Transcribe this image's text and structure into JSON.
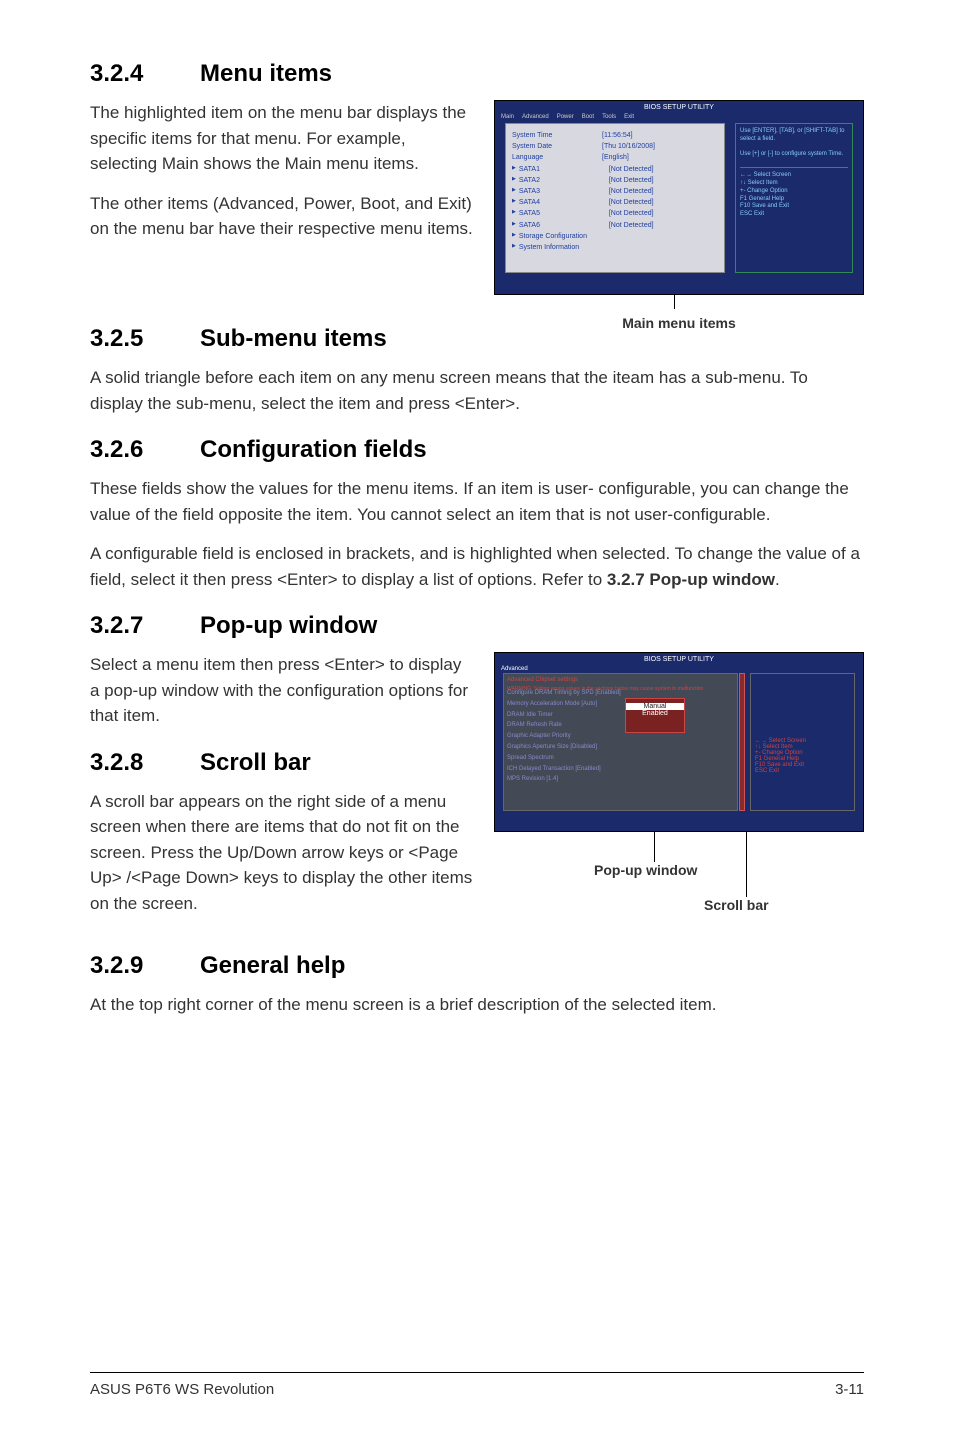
{
  "sec324": {
    "no": "3.2.4",
    "title": "Menu items",
    "p1": "The highlighted item on the menu bar displays the specific items for that menu. For example, selecting Main shows the Main menu items.",
    "p2": "The other items (Advanced, Power, Boot, and Exit) on the menu bar have their respective menu items."
  },
  "fig1": {
    "title_top": "BIOS SETUP UTILITY",
    "menu": [
      "Main",
      "Advanced",
      "Power",
      "Boot",
      "Tools",
      "Exit"
    ],
    "rows": [
      {
        "lbl": "System Time",
        "val": "[11:56:54]"
      },
      {
        "lbl": "System Date",
        "val": "[Thu 10/16/2008]"
      },
      {
        "lbl": "Language",
        "val": "[English]"
      },
      {
        "lbl": "SATA1",
        "val": "[Not Detected]",
        "tri": true
      },
      {
        "lbl": "SATA2",
        "val": "[Not Detected]",
        "tri": true
      },
      {
        "lbl": "SATA3",
        "val": "[Not Detected]",
        "tri": true
      },
      {
        "lbl": "SATA4",
        "val": "[Not Detected]",
        "tri": true
      },
      {
        "lbl": "SATA5",
        "val": "[Not Detected]",
        "tri": true
      },
      {
        "lbl": "SATA6",
        "val": "[Not Detected]",
        "tri": true
      },
      {
        "lbl": "Storage Configuration",
        "val": "",
        "tri": true
      },
      {
        "lbl": "System Information",
        "val": "",
        "tri": true
      }
    ],
    "help": "Use [ENTER], [TAB], or [SHIFT-TAB] to select a field.\n\nUse [+] or [-] to configure system Time.",
    "legend": "←→   Select Screen\n↑↓   Select Item\n+-   Change Option\nF1   General Help\nF10  Save and Exit\nESC  Exit",
    "caption": "Main menu items"
  },
  "sec325": {
    "no": "3.2.5",
    "title": "Sub-menu items",
    "p1": "A solid triangle before each item on any menu screen means that the iteam has a sub-menu. To display the sub-menu, select the item and press <Enter>."
  },
  "sec326": {
    "no": "3.2.6",
    "title": "Configuration fields",
    "p1": "These fields show the values for the menu items. If an item is user- configurable, you can change the value of the field opposite the item. You cannot select an item that is not user-configurable.",
    "p2a": "A configurable field is enclosed in brackets, and is highlighted when selected. To change the value of a field, select it then press <Enter> to display a list of options. Refer to ",
    "p2b": "3.2.7 Pop-up window",
    "p2c": "."
  },
  "sec327": {
    "no": "3.2.7",
    "title": "Pop-up window",
    "p1": "Select a menu item then press <Enter> to display a pop-up window with the configuration options for that item."
  },
  "sec328": {
    "no": "3.2.8",
    "title": "Scroll bar",
    "p1": "A scroll bar appears on the right side of a menu screen when there are items that do not fit on the screen. Press the Up/Down arrow keys or <Page Up> /<Page Down> keys to display the other items on the screen."
  },
  "fig2": {
    "title_top": "BIOS SETUP UTILITY",
    "menu_sel": "Advanced",
    "header": "Advanced Chipset settings",
    "warning": "WARNING: Setting wrong values in the sections below may cause system to malfunction",
    "lines": [
      "Configure DRAM Timing by SPD   [Enabled]",
      "Memory Acceleration Mode   [Auto]",
      "DRAM Idle Timer",
      "DRAM Refresh Rate",
      "",
      "Graphic Adapter Priority",
      "Graphics Aperture Size  [Disabled]",
      "Spread Spectrum",
      "",
      "ICH Delayed Transaction  [Enabled]",
      "",
      "MPS Revision            [1.4]"
    ],
    "popup": [
      "Manual",
      "Enabled"
    ],
    "legend": "←→  Select Screen\n↑↓  Select Item\n+-  Change Option\nF1  General Help\nF10 Save and Exit\nESC Exit",
    "cap1": "Pop-up window",
    "cap2": "Scroll bar"
  },
  "sec329": {
    "no": "3.2.9",
    "title": "General help",
    "p1": "At the top right corner of the menu screen is a brief description of the selected item."
  },
  "footer": {
    "left": "ASUS P6T6 WS Revolution",
    "right": "3-11"
  }
}
